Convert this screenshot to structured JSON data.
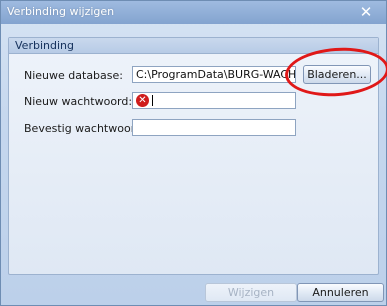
{
  "window": {
    "title": "Verbinding wijzigen",
    "close_glyph": "✕"
  },
  "panel": {
    "title": "Verbinding"
  },
  "fields": {
    "database": {
      "label": "Nieuwe database:",
      "value": "C:\\ProgramData\\BURG-WACHTER\\"
    },
    "password": {
      "label": "Nieuw wachtwoord:",
      "value": ""
    },
    "confirm": {
      "label": "Bevestig wachtwoord:",
      "value": ""
    }
  },
  "buttons": {
    "browse": "Bladeren...",
    "ok": "Wijzigen",
    "cancel": "Annuleren"
  },
  "colors": {
    "highlight": "#e01818",
    "error": "#cf1c1c",
    "accent": "#83a3cf"
  }
}
